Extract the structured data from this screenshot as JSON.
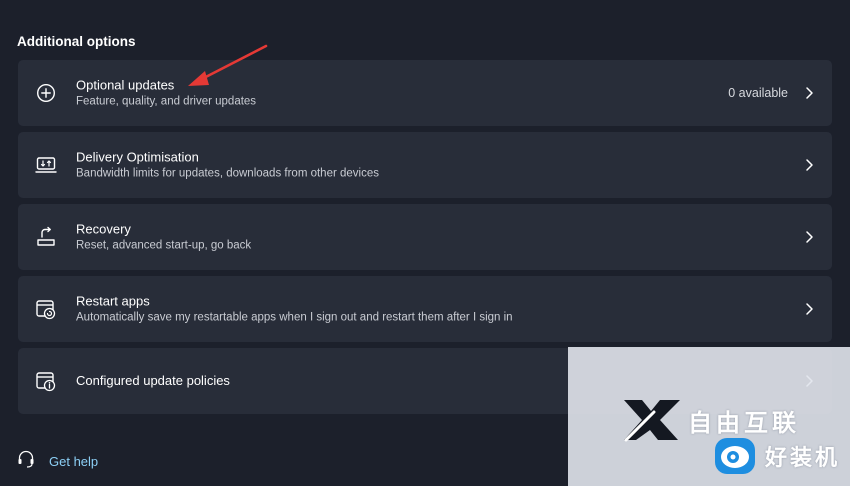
{
  "section": {
    "title": "Additional options"
  },
  "items": [
    {
      "icon": "add-circle-icon",
      "title": "Optional updates",
      "subtitle": "Feature, quality, and driver updates",
      "status": "0 available"
    },
    {
      "icon": "delivery-optimisation-icon",
      "title": "Delivery Optimisation",
      "subtitle": "Bandwidth limits for updates, downloads from other devices"
    },
    {
      "icon": "recovery-icon",
      "title": "Recovery",
      "subtitle": "Reset, advanced start-up, go back"
    },
    {
      "icon": "restart-apps-icon",
      "title": "Restart apps",
      "subtitle": "Automatically save my restartable apps when I sign out and restart them after I sign in"
    },
    {
      "icon": "policy-info-icon",
      "title": "Configured update policies"
    }
  ],
  "help": {
    "label": "Get help"
  },
  "watermark": {
    "line1": "自由互联",
    "line2": "好装机"
  },
  "colors": {
    "background": "#1c202b",
    "card": "#282d39",
    "link": "#8ccff5",
    "annotation_arrow": "#e53935"
  }
}
